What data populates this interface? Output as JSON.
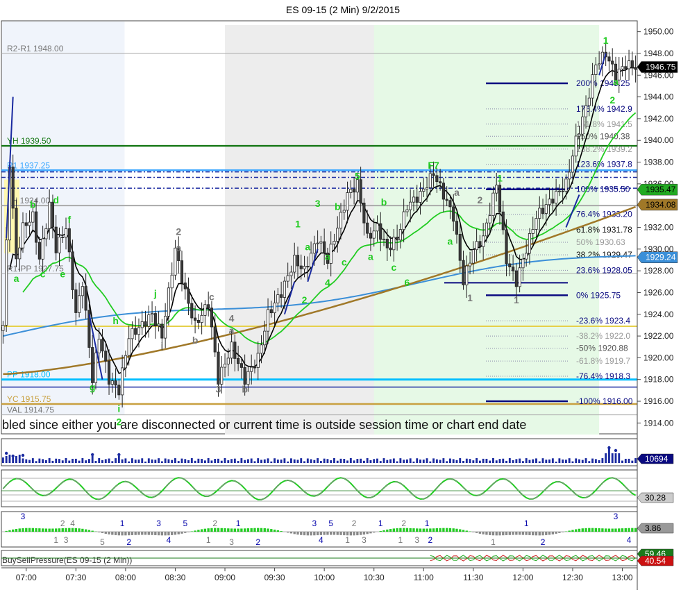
{
  "title": "ES 09-15 (2 Min)  9/2/2015",
  "colors": {
    "up": "#ffffff",
    "down": "#3a3a3a",
    "wick": "#222222",
    "ema_fast": "#000000",
    "ema_mid": "#22cc22",
    "ema_slow": "#a07828",
    "ema_long": "#3b8fd8",
    "wave_green": "#22cc22",
    "wave_gray": "#777777",
    "fib_blue": "#0a0a80",
    "yh": "#1a7a1a",
    "yc": "#c8a040",
    "pp": "#00bfff",
    "session_green": "#e6f9e6",
    "session_gray": "#ededed",
    "session_blue": "#f0f4fb"
  },
  "notice": "bled since either you are disconnected or current time is outside session time or chart end date",
  "indicator_values": {
    "volume": "10694",
    "osc1": "30.28",
    "osc2": "3.86",
    "bsp_a": "59.46",
    "bsp_b": "40.54"
  },
  "bsp_label": "BuySellPressure(ES 09-15 (2 Min))",
  "chart_data": {
    "type": "candlestick",
    "title": "ES 09-15 (2 Min)  9/2/2015",
    "y_axis": {
      "range": [
        1913.0,
        1951.0
      ],
      "ticks": [
        "1914.00",
        "1916.00",
        "1918.00",
        "1920.00",
        "1922.00",
        "1924.00",
        "1926.00",
        "1928.00",
        "1930.00",
        "1932.00",
        "1934.00",
        "1936.00",
        "1938.00",
        "1940.00",
        "1942.00",
        "1944.00",
        "1946.00",
        "1948.00",
        "1950.00"
      ]
    },
    "x_axis": {
      "ticks": [
        "07:00",
        "07:30",
        "08:00",
        "08:30",
        "09:00",
        "09:30",
        "10:00",
        "10:30",
        "11:00",
        "11:30",
        "12:00",
        "12:30",
        "13:00"
      ],
      "first_tick_bar": 7,
      "bars_per_tick": 15
    },
    "axis_price_labels": [
      {
        "text": "1946.75",
        "value": 1946.75,
        "bg": "#000000",
        "fg": "#ffffff"
      },
      {
        "text": "1935.47",
        "value": 1935.47,
        "bg": "#22aa22",
        "fg": "#000000"
      },
      {
        "text": "1934.08",
        "value": 1934.08,
        "bg": "#a07828",
        "fg": "#000000"
      },
      {
        "text": "1929.24",
        "value": 1929.24,
        "bg": "#3b8fd8",
        "fg": "#ffffff"
      }
    ],
    "level_lines": [
      {
        "label": "R2-R1 1948.00",
        "value": 1948.0,
        "color": "#aaaaaa",
        "width": 1
      },
      {
        "label": "YH 1939.50",
        "value": 1939.5,
        "color": "#1a7a1a",
        "width": 2.5
      },
      {
        "label": "R1 1937.25",
        "value": 1937.25,
        "color": "#3fa9ff",
        "width": 2.5
      },
      {
        "label": "LH 1934.00",
        "value": 1934.0,
        "color": "#aaaaaa",
        "width": 2
      },
      {
        "label": "R1-PP 1927.75",
        "value": 1927.75,
        "color": "#aaaaaa",
        "width": 1
      },
      {
        "label": "PP 1918.00",
        "value": 1918.0,
        "color": "#00bfff",
        "width": 3
      },
      {
        "label": "YC 1915.75",
        "value": 1915.75,
        "color": "#c8a040",
        "width": 2.5
      },
      {
        "label": "VAL 1914.75",
        "value": 1914.75,
        "color": "#aaaaaa",
        "width": 1
      }
    ],
    "fib_levels": [
      {
        "label": "200%  1945.25",
        "value": 1945.25,
        "color": "#0a0a80"
      },
      {
        "label": "176.4%  1942.9",
        "value": 1942.9,
        "color": "#0a0a80"
      },
      {
        "label": "161.8%  1941.5",
        "value": 1941.5,
        "color": "#999999"
      },
      {
        "label": "150%  1940.38",
        "value": 1940.38,
        "color": "#555555"
      },
      {
        "label": "138.2%  1939.2",
        "value": 1939.2,
        "color": "#999999"
      },
      {
        "label": "123.6%  1937.8",
        "value": 1937.8,
        "color": "#0a0a80"
      },
      {
        "label": "100%  1935.50",
        "value": 1935.5,
        "color": "#0a0a80"
      },
      {
        "label": "76.4%  1933.20",
        "value": 1933.2,
        "color": "#0a0a80"
      },
      {
        "label": "61.8%  1931.78",
        "value": 1931.78,
        "color": "#111111"
      },
      {
        "label": "50%  1930.63",
        "value": 1930.63,
        "color": "#999999"
      },
      {
        "label": "38.2%  1929.47",
        "value": 1929.47,
        "color": "#111111"
      },
      {
        "label": "23.6%  1928.05",
        "value": 1928.05,
        "color": "#0a0a80"
      },
      {
        "label": "0%  1925.75",
        "value": 1925.75,
        "color": "#0a0a80"
      },
      {
        "label": "-23.6%  1923.4",
        "value": 1923.4,
        "color": "#0a0a80"
      },
      {
        "label": "-38.2%  1922.0",
        "value": 1922.0,
        "color": "#999999"
      },
      {
        "label": "-50%  1920.88",
        "value": 1920.88,
        "color": "#555555"
      },
      {
        "label": "-61.8%  1919.7",
        "value": 1919.7,
        "color": "#999999"
      },
      {
        "label": "-76.4%  1918.3",
        "value": 1918.3,
        "color": "#0a0a80"
      },
      {
        "label": "-100%  1916.00",
        "value": 1916.0,
        "color": "#0a0a80"
      }
    ],
    "wave_labels": [
      {
        "text": "1",
        "bar": 182,
        "value": 1948.9,
        "color": "#22cc22"
      },
      {
        "text": "a",
        "bar": 185,
        "value": 1945.1,
        "color": "#22cc22"
      },
      {
        "text": "2",
        "bar": 184,
        "value": 1943.4,
        "color": "#22cc22"
      },
      {
        "text": "F7",
        "bar": 130,
        "value": 1937.4,
        "color": "#22cc22"
      },
      {
        "text": "5",
        "bar": 107,
        "value": 1936.4,
        "color": "#22cc22"
      },
      {
        "text": "1",
        "bar": 150,
        "value": 1936.2,
        "color": "#22cc22"
      },
      {
        "text": "b",
        "bar": 9,
        "value": 1933.8,
        "color": "#22cc22"
      },
      {
        "text": "d",
        "bar": 16,
        "value": 1934.2,
        "color": "#22cc22"
      },
      {
        "text": "f",
        "bar": 20,
        "value": 1932.4,
        "color": "#22cc22"
      },
      {
        "text": "a",
        "bar": 4,
        "value": 1927.0,
        "color": "#22cc22"
      },
      {
        "text": "c",
        "bar": 12,
        "value": 1927.4,
        "color": "#22cc22"
      },
      {
        "text": "e",
        "bar": 18,
        "value": 1927.4,
        "color": "#22cc22"
      },
      {
        "text": "g",
        "bar": 27,
        "value": 1917.0,
        "color": "#22cc22"
      },
      {
        "text": "h",
        "bar": 34,
        "value": 1923.1,
        "color": "#22cc22"
      },
      {
        "text": "i",
        "bar": 35,
        "value": 1915.0,
        "color": "#22cc22"
      },
      {
        "text": "2",
        "bar": 35,
        "value": 1913.8,
        "color": "#22cc22"
      },
      {
        "text": "j",
        "bar": 46,
        "value": 1925.6,
        "color": "#22cc22"
      },
      {
        "text": "i",
        "bar": 48,
        "value": 1920.8,
        "color": "#777777"
      },
      {
        "text": "2",
        "bar": 53,
        "value": 1931.3,
        "color": "#777777"
      },
      {
        "text": "a",
        "bar": 53,
        "value": 1929.8,
        "color": "#777777"
      },
      {
        "text": "b",
        "bar": 58,
        "value": 1921.3,
        "color": "#777777"
      },
      {
        "text": "c",
        "bar": 63,
        "value": 1925.3,
        "color": "#777777"
      },
      {
        "text": "4",
        "bar": 69,
        "value": 1923.3,
        "color": "#777777"
      },
      {
        "text": "a",
        "bar": 69,
        "value": 1922.2,
        "color": "#777777"
      },
      {
        "text": "3",
        "bar": 65,
        "value": 1916.8,
        "color": "#777777"
      },
      {
        "text": "b",
        "bar": 73,
        "value": 1916.8,
        "color": "#777777"
      },
      {
        "text": "1",
        "bar": 89,
        "value": 1932.0,
        "color": "#22cc22"
      },
      {
        "text": "2",
        "bar": 91,
        "value": 1925.0,
        "color": "#22cc22"
      },
      {
        "text": "a",
        "bar": 92,
        "value": 1929.9,
        "color": "#22cc22"
      },
      {
        "text": "3",
        "bar": 95,
        "value": 1933.9,
        "color": "#22cc22"
      },
      {
        "text": "a",
        "bar": 98,
        "value": 1929.0,
        "color": "#22cc22"
      },
      {
        "text": "4",
        "bar": 98,
        "value": 1926.6,
        "color": "#22cc22"
      },
      {
        "text": "b",
        "bar": 101,
        "value": 1933.6,
        "color": "#22cc22"
      },
      {
        "text": "c",
        "bar": 103,
        "value": 1928.5,
        "color": "#22cc22"
      },
      {
        "text": "a",
        "bar": 111,
        "value": 1929.0,
        "color": "#22cc22"
      },
      {
        "text": "b",
        "bar": 115,
        "value": 1934.0,
        "color": "#22cc22"
      },
      {
        "text": "c",
        "bar": 118,
        "value": 1928.0,
        "color": "#22cc22"
      },
      {
        "text": "6",
        "bar": 122,
        "value": 1926.6,
        "color": "#22cc22"
      },
      {
        "text": "a",
        "bar": 137,
        "value": 1934.9,
        "color": "#777777"
      },
      {
        "text": "a",
        "bar": 135,
        "value": 1930.4,
        "color": "#22cc22"
      },
      {
        "text": "2",
        "bar": 144,
        "value": 1934.2,
        "color": "#777777"
      },
      {
        "text": "1",
        "bar": 141,
        "value": 1925.2,
        "color": "#777777"
      },
      {
        "text": "1",
        "bar": 155,
        "value": 1925.0,
        "color": "#777777"
      }
    ],
    "bottom_wave_labels": [
      {
        "text": "3",
        "bar": 6,
        "row": 0,
        "color": "#0000aa"
      },
      {
        "text": "2",
        "bar": 18,
        "row": 1,
        "color": "#777777"
      },
      {
        "text": "4",
        "bar": 21,
        "row": 1,
        "color": "#777777"
      },
      {
        "text": "1",
        "bar": 16,
        "row": 2,
        "color": "#777777"
      },
      {
        "text": "3",
        "bar": 19,
        "row": 2,
        "color": "#777777"
      },
      {
        "text": "1",
        "bar": 36,
        "row": 1,
        "color": "#0000aa"
      },
      {
        "text": "5",
        "bar": 30,
        "row": 3,
        "color": "#777777"
      },
      {
        "text": "2",
        "bar": 38,
        "row": 3,
        "color": "#0000aa"
      },
      {
        "text": "3",
        "bar": 47,
        "row": 1,
        "color": "#0000aa"
      },
      {
        "text": "4",
        "bar": 50,
        "row": 2,
        "color": "#0000aa"
      },
      {
        "text": "5",
        "bar": 55,
        "row": 1,
        "color": "#0000aa"
      },
      {
        "text": "2",
        "bar": 64,
        "row": 1,
        "color": "#777777"
      },
      {
        "text": "1",
        "bar": 62,
        "row": 2,
        "color": "#777777"
      },
      {
        "text": "1",
        "bar": 71,
        "row": 1,
        "color": "#0000aa"
      },
      {
        "text": "3",
        "bar": 69,
        "row": 3,
        "color": "#777777"
      },
      {
        "text": "2",
        "bar": 77,
        "row": 3,
        "color": "#0000aa"
      },
      {
        "text": "3",
        "bar": 94,
        "row": 1,
        "color": "#0000aa"
      },
      {
        "text": "5",
        "bar": 99,
        "row": 1,
        "color": "#0000aa"
      },
      {
        "text": "4",
        "bar": 96,
        "row": 2,
        "color": "#0000aa"
      },
      {
        "text": "2",
        "bar": 106,
        "row": 1,
        "color": "#777777"
      },
      {
        "text": "1",
        "bar": 104,
        "row": 2,
        "color": "#777777"
      },
      {
        "text": "3",
        "bar": 109,
        "row": 2,
        "color": "#777777"
      },
      {
        "text": "1",
        "bar": 114,
        "row": 1,
        "color": "#0000aa"
      },
      {
        "text": "2",
        "bar": 121,
        "row": 1,
        "color": "#777777"
      },
      {
        "text": "1",
        "bar": 120,
        "row": 2,
        "color": "#777777"
      },
      {
        "text": "3",
        "bar": 125,
        "row": 2,
        "color": "#777777"
      },
      {
        "text": "1",
        "bar": 128,
        "row": 1,
        "color": "#0000aa"
      },
      {
        "text": "2",
        "bar": 129,
        "row": 2,
        "color": "#0000aa"
      },
      {
        "text": "1",
        "bar": 148,
        "row": 3,
        "color": "#777777"
      },
      {
        "text": "1",
        "bar": 158,
        "row": 1,
        "color": "#0000aa"
      },
      {
        "text": "2",
        "bar": 163,
        "row": 3,
        "color": "#0000aa"
      },
      {
        "text": "3",
        "bar": 185,
        "row": 0,
        "color": "#0000aa"
      },
      {
        "text": "4",
        "bar": 189,
        "row": 2,
        "color": "#0000aa"
      }
    ],
    "grid": false,
    "legend": "none"
  }
}
